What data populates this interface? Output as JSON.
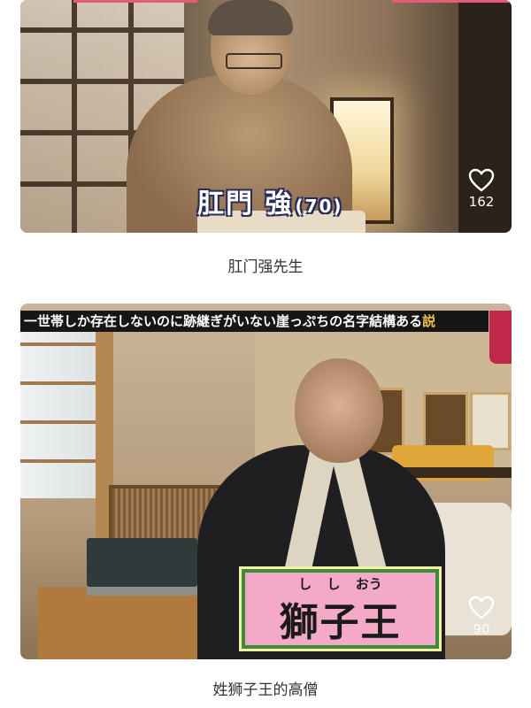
{
  "posts": [
    {
      "caption_overlay": "肛門 強",
      "caption_age": "(70)",
      "likes": "162",
      "title": "肛门强先生"
    },
    {
      "banner": "一世帯しか存在しないのに跡継ぎがいない崖っぷちの名字結構ある",
      "banner_highlight": "説",
      "name_ruby": "し し おう",
      "name_overlay": "獅子王",
      "likes": "90",
      "title": "姓狮子王的高僧"
    }
  ],
  "icons": {
    "like": "heart-icon"
  },
  "colors": {
    "accent": "#e85a7a",
    "name_box_bg": "#f4a9c7",
    "name_box_border": "#3c8a3a"
  }
}
